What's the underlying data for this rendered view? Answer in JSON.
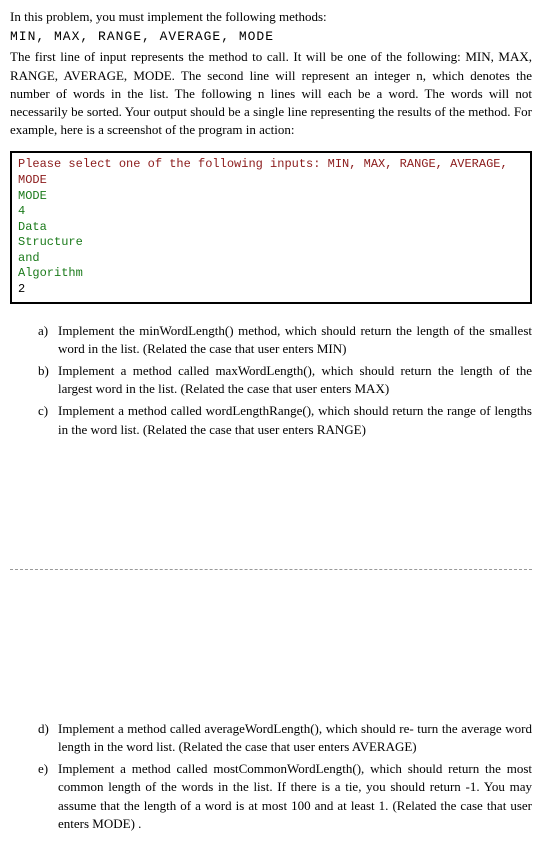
{
  "intro": {
    "line1": "In this problem, you must implement the following methods:",
    "methods": "MIN, MAX, RANGE, AVERAGE, MODE",
    "paragraph": "The first line of input represents the method to call. It will be one of the following: MIN, MAX, RANGE, AVERAGE, MODE. The second line will represent an integer n, which denotes the number of words in the list. The following n lines will each be a word. The words will not necessarily be sorted. Your output should be a single line representing the results of the method. For example, here is a screenshot of the program in action:"
  },
  "code": {
    "prompt": "Please select one of the following inputs: MIN, MAX, RANGE, AVERAGE, MODE",
    "lines": [
      "MODE",
      "4",
      "Data",
      "Structure",
      "and",
      "Algorithm"
    ],
    "result": "2"
  },
  "items_top": [
    {
      "marker": "a)",
      "text": "Implement the minWordLength() method, which should return the length of the smallest word in the list. (Related the case that user enters MIN)"
    },
    {
      "marker": "b)",
      "text": "Implement a method called maxWordLength(), which should return the length of the largest word in the list. (Related the case that user enters MAX)"
    },
    {
      "marker": "c)",
      "text": "Implement a method called wordLengthRange(), which should return the range of lengths in the word list.  (Related the case that user enters RANGE)"
    }
  ],
  "items_bottom": [
    {
      "marker": "d)",
      "text": "Implement a method called averageWordLength(), which should re- turn the average word length in the word list. (Related the case that user enters AVERAGE)"
    },
    {
      "marker": "e)",
      "text": "Implement a method called mostCommonWordLength(), which should return the most common length of the words in the list. If there is a tie, you should return -1. You may assume that the length of a word is at most 100 and at least 1. (Related the case that user enters MODE) ."
    }
  ]
}
